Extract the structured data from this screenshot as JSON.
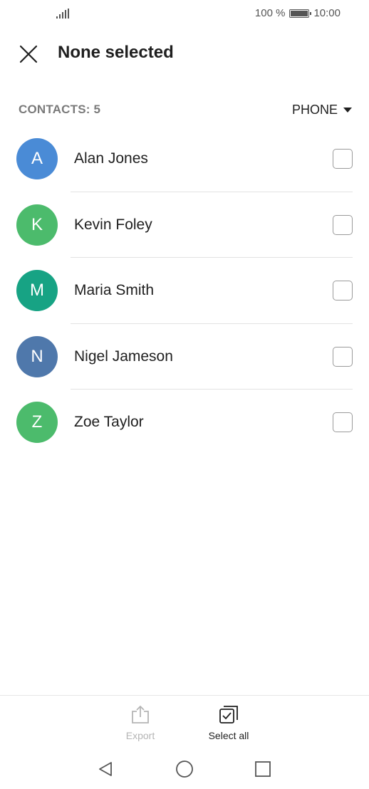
{
  "status_bar": {
    "battery_percent": "100 %",
    "time": "10:00",
    "icons": [
      "signal-icon",
      "battery-icon"
    ]
  },
  "header": {
    "title": "None selected",
    "close_icon": "close-icon"
  },
  "summary": {
    "contacts_count": "CONTACTS: 5",
    "filter_label": "PHONE",
    "filter_icon": "caret-down-icon"
  },
  "contacts": [
    {
      "initial": "A",
      "name": "Alan Jones",
      "color": "#4a8bd6"
    },
    {
      "initial": "K",
      "name": "Kevin Foley",
      "color": "#4cbb6c"
    },
    {
      "initial": "M",
      "name": "Maria Smith",
      "color": "#17a384"
    },
    {
      "initial": "N",
      "name": "Nigel Jameson",
      "color": "#4f78ab"
    },
    {
      "initial": "Z",
      "name": "Zoe Taylor",
      "color": "#4cbb6c"
    }
  ],
  "bottom_actions": {
    "export_label": "Export",
    "select_all_label": "Select all",
    "export_icon": "export-icon",
    "select_all_icon": "select-all-icon"
  },
  "nav": {
    "icons": [
      "back-icon",
      "home-icon",
      "recents-icon"
    ]
  }
}
